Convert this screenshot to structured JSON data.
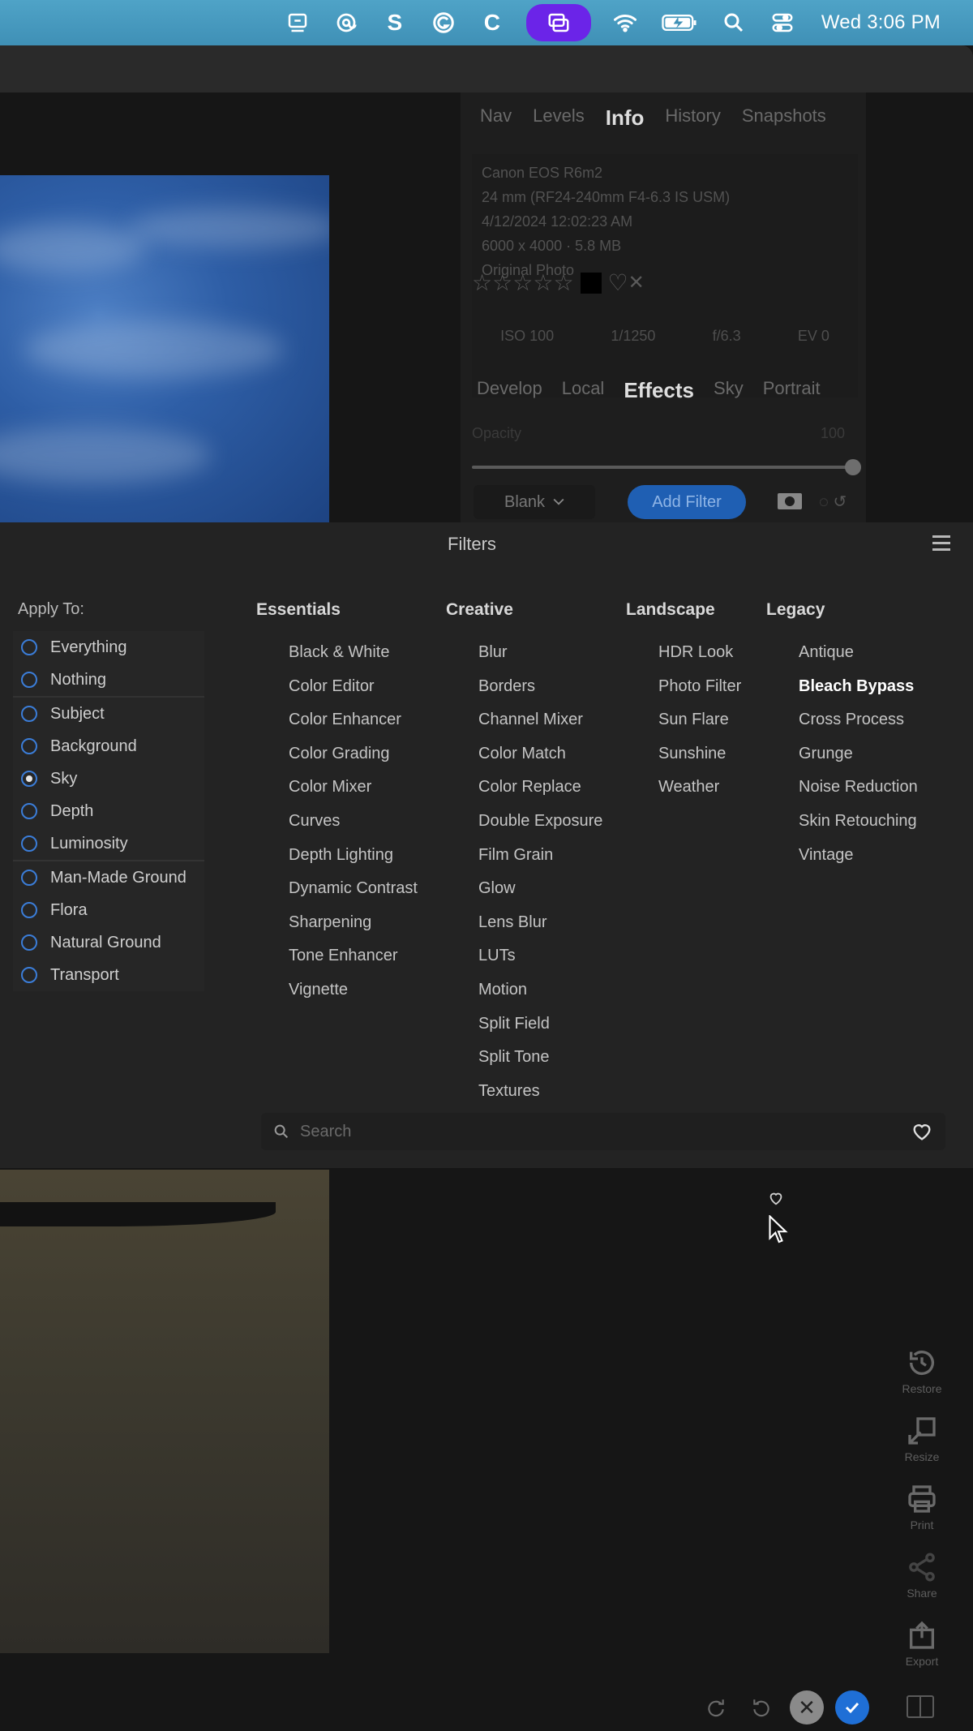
{
  "menubar": {
    "icons": [
      "display-icon",
      "at-sign-icon",
      "s-app-icon",
      "grammarly-icon",
      "c-app-icon",
      "screen-mirroring-icon",
      "wifi-icon",
      "battery-icon",
      "spotlight-search-icon",
      "control-center-icon"
    ],
    "clock": "Wed 3:06 PM",
    "accent": "#6b24e8"
  },
  "panel": {
    "top_tabs": [
      "Nav",
      "Levels",
      "Info",
      "History",
      "Snapshots"
    ],
    "active_top_tab": "Info",
    "meta": [
      "Canon EOS R6m2",
      "24 mm (RF24-240mm F4-6.3 IS USM)",
      "4/12/2024 12:02:23 AM",
      "6000 x 4000 · 5.8 MB",
      "Original Photo"
    ],
    "exif": [
      "ISO 100",
      "1/1250",
      "f/6.3",
      "EV 0"
    ],
    "sub_tabs": [
      "Develop",
      "Local",
      "Effects",
      "Sky",
      "Portrait"
    ],
    "active_sub_tab": "Effects",
    "opacity_label": "Opacity",
    "opacity_value": "100",
    "opacity_level": 1.0,
    "preset": "Blank",
    "add_filter": "Add Filter",
    "accent": "#1f5fb3"
  },
  "filters": {
    "title": "Filters",
    "apply_to_label": "Apply To:",
    "apply_groups": [
      [
        {
          "label": "Everything",
          "selected": false
        },
        {
          "label": "Nothing",
          "selected": false
        }
      ],
      [
        {
          "label": "Subject",
          "selected": false
        },
        {
          "label": "Background",
          "selected": false
        },
        {
          "label": "Sky",
          "selected": true
        },
        {
          "label": "Depth",
          "selected": false
        },
        {
          "label": "Luminosity",
          "selected": false
        }
      ],
      [
        {
          "label": "Man-Made Ground",
          "selected": false
        },
        {
          "label": "Flora",
          "selected": false
        },
        {
          "label": "Natural Ground",
          "selected": false
        },
        {
          "label": "Transport",
          "selected": false
        }
      ]
    ],
    "columns": [
      {
        "id": "essentials",
        "title": "Essentials",
        "items": [
          "Black & White",
          "Color Editor",
          "Color Enhancer",
          "Color Grading",
          "Color Mixer",
          "Curves",
          "Depth Lighting",
          "Dynamic Contrast",
          "Sharpening",
          "Tone Enhancer",
          "Vignette"
        ]
      },
      {
        "id": "creative",
        "title": "Creative",
        "items": [
          "Blur",
          "Borders",
          "Channel Mixer",
          "Color Match",
          "Color Replace",
          "Double Exposure",
          "Film Grain",
          "Glow",
          "Lens Blur",
          "LUTs",
          "Motion",
          "Split Field",
          "Split Tone",
          "Textures"
        ]
      },
      {
        "id": "landscape",
        "title": "Landscape",
        "items": [
          "HDR Look",
          "Photo Filter",
          "Sun Flare",
          "Sunshine",
          "Weather"
        ]
      },
      {
        "id": "legacy",
        "title": "Legacy",
        "items": [
          "Antique",
          "Bleach Bypass",
          "Cross Process",
          "Grunge",
          "Noise Reduction",
          "Skin Retouching",
          "Vintage"
        ]
      }
    ],
    "hovered_item": "Bleach Bypass",
    "search_placeholder": "Search"
  },
  "side_tools": [
    "Restore",
    "Resize",
    "Print",
    "Share",
    "Export"
  ]
}
